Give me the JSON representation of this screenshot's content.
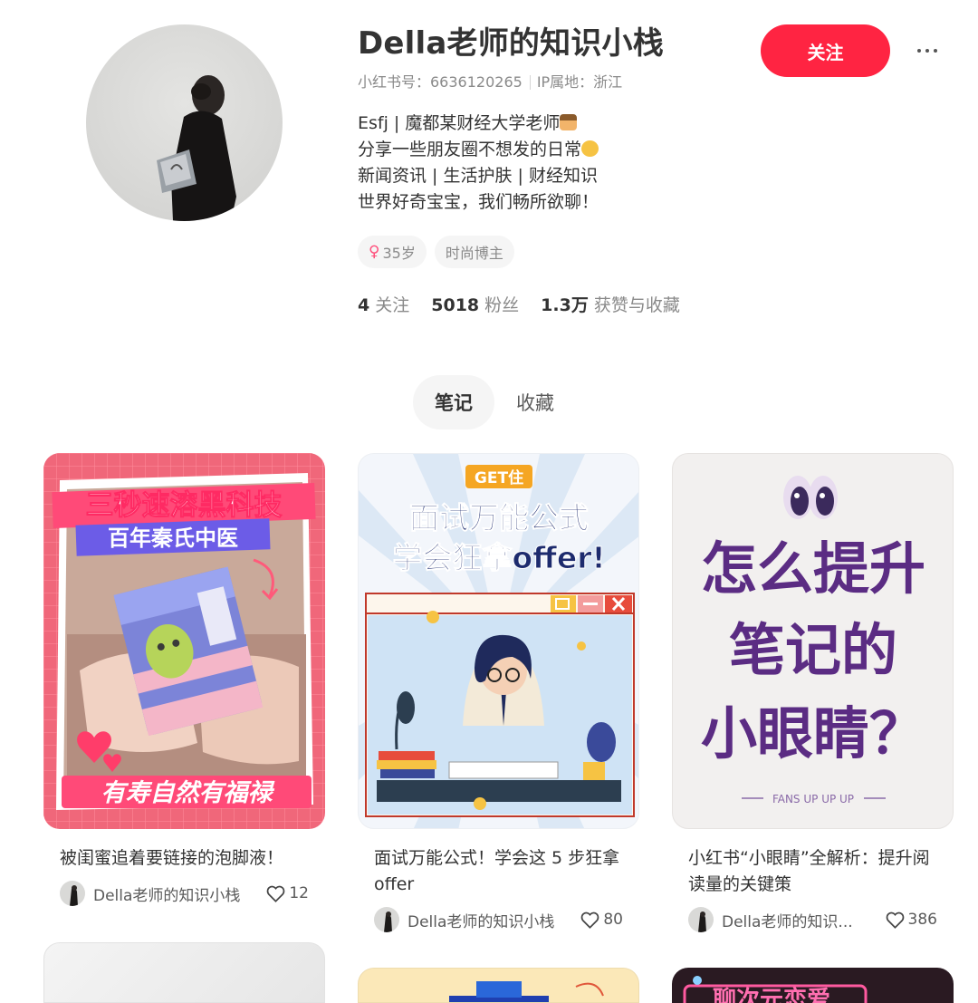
{
  "profile": {
    "nickname": "Della老师的知识小栈",
    "red_id": "小红书号：6636120265",
    "ip_location": "IP属地：浙江",
    "bio": [
      "Esfj | 魔都某财经大学老师",
      "分享一些朋友圈不想发的日常",
      "新闻资讯 | 生活护肤 | 财经知识",
      "世界好奇宝宝，我们畅所欲聊！"
    ],
    "tags": {
      "age": "35岁",
      "category": "时尚博主"
    },
    "stats": [
      {
        "num": "4",
        "label": "关注"
      },
      {
        "num": "5018",
        "label": "粉丝"
      },
      {
        "num": "1.3万",
        "label": "获赞与收藏"
      }
    ],
    "follow_label": "关注"
  },
  "tabs": [
    "笔记",
    "收藏"
  ],
  "notes": [
    {
      "title": "被闺蜜追着要链接的泡脚液！",
      "author": "Della老师的知识小栈",
      "likes": "12",
      "cover": {
        "line1": "三秒速溶黑科技",
        "line2": "百年秦氏中医",
        "bottom": "有寿自然有福禄"
      }
    },
    {
      "title": "面试万能公式！学会这 5 步狂拿 offer",
      "author": "Della老师的知识小栈",
      "likes": "80",
      "cover": {
        "badge": "GET住",
        "line1": "面试万能公式",
        "line2": "学会狂拿offer!"
      }
    },
    {
      "title": "小红书“小眼睛”全解析：提升阅读量的关键策",
      "author": "Della老师的知识...",
      "likes": "386",
      "cover": {
        "line1": "怎么提升",
        "line2": "笔记的",
        "line3": "小眼睛？",
        "footer": "FANS UP UP UP"
      }
    }
  ],
  "partial_cover_text": "聊次元恋爱",
  "colors": {
    "accent": "#ff2442",
    "cover3_text": "#5b2c83"
  }
}
